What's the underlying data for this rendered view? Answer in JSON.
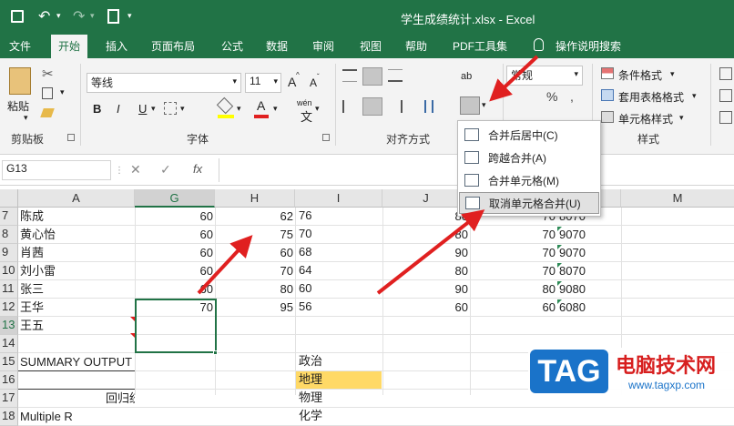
{
  "titlebar": {
    "filename": "学生成绩统计.xlsx",
    "sep": " - ",
    "app": "Excel"
  },
  "tabs": [
    "文件",
    "开始",
    "插入",
    "页面布局",
    "公式",
    "数据",
    "审阅",
    "视图",
    "帮助",
    "PDF工具集",
    "操作说明搜索"
  ],
  "ribbon": {
    "paste_label": "粘贴",
    "clipboard_group": "剪贴板",
    "font_name": "等线",
    "font_size": "11",
    "font_group": "字体",
    "align_group": "对齐方式",
    "number_format": "常规",
    "style_group": "样式",
    "cond_format": "条件格式",
    "table_format": "套用表格格式",
    "cell_style": "单元格样式",
    "bold": "B",
    "italic": "I",
    "underline": "U",
    "grow": "A",
    "shrink": "A",
    "fontcolor": "A",
    "wen": "wén",
    "ab": "ab",
    "percent": "%",
    "comma": ","
  },
  "formula_bar": {
    "name_box": "G13",
    "fx": "fx",
    "cancel": "✕",
    "enter": "✓"
  },
  "merge_menu": [
    {
      "label": "合并后居中(C)"
    },
    {
      "label": "跨越合并(A)"
    },
    {
      "label": "合并单元格(M)"
    },
    {
      "label": "取消单元格合并(U)"
    }
  ],
  "columns": [
    "A",
    "G",
    "H",
    "I",
    "J",
    "M"
  ],
  "rows": [
    {
      "num": "7",
      "name": "陈成",
      "g": "60",
      "h": "62",
      "i": "76",
      "j": "80",
      "k": "70",
      "l": "8070"
    },
    {
      "num": "8",
      "name": "黄心怡",
      "g": "60",
      "h": "75",
      "i": "70",
      "j": "80",
      "k": "70",
      "l": "9070"
    },
    {
      "num": "9",
      "name": "肖茜",
      "g": "60",
      "h": "60",
      "i": "68",
      "j": "90",
      "k": "70",
      "l": "9070"
    },
    {
      "num": "10",
      "name": "刘小雷",
      "g": "60",
      "h": "70",
      "i": "64",
      "j": "80",
      "k": "70",
      "l": "8070"
    },
    {
      "num": "11",
      "name": "张三",
      "g": "60",
      "h": "80",
      "i": "60",
      "j": "90",
      "k": "80",
      "l": "9080"
    },
    {
      "num": "12",
      "name": "王华",
      "g": "70",
      "h": "95",
      "i": "56",
      "j": "60",
      "k": "60",
      "l": "6080"
    },
    {
      "num": "13",
      "name": "王五"
    },
    {
      "num": "14"
    },
    {
      "num": "15",
      "name": "SUMMARY OUTPUT",
      "i": "政治"
    },
    {
      "num": "16",
      "i": "地理"
    },
    {
      "num": "17",
      "mid": "回归统",
      "i": "物理"
    },
    {
      "num": "18",
      "name": "Multiple R",
      "i": "化学"
    }
  ],
  "watermark": {
    "logo": "TAG",
    "title": "电脑技术网",
    "url": "www.tagxp.com"
  },
  "colors": {
    "excel_green": "#217346",
    "selection": "#217346",
    "highlight": "#ffd966",
    "arrow": "#e02020"
  }
}
